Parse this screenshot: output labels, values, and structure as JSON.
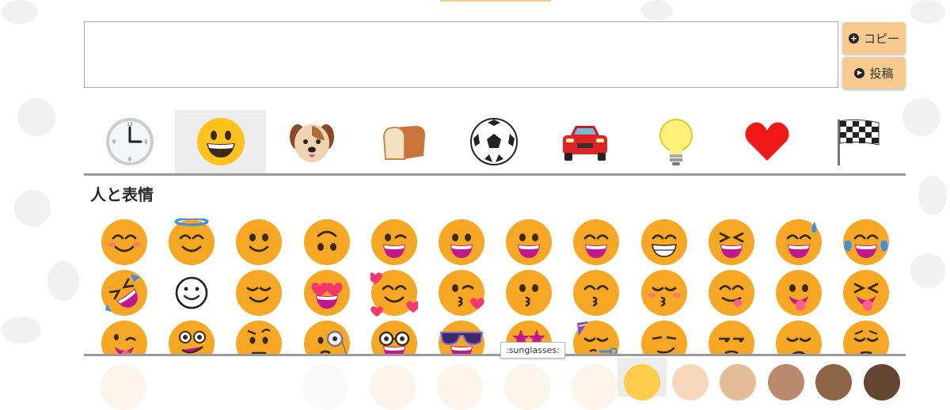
{
  "composer": {
    "text_value": "",
    "copy_label": "コピー",
    "post_label": "投稿"
  },
  "categories": [
    {
      "name": "clock",
      "active": false
    },
    {
      "name": "grinning-face",
      "active": true
    },
    {
      "name": "dog-face",
      "active": false
    },
    {
      "name": "bread",
      "active": false
    },
    {
      "name": "soccer-ball",
      "active": false
    },
    {
      "name": "car",
      "active": false
    },
    {
      "name": "light-bulb",
      "active": false
    },
    {
      "name": "red-heart",
      "active": false
    },
    {
      "name": "chequered-flag",
      "active": false
    }
  ],
  "section": {
    "title": "人と表情"
  },
  "emoji_rows": [
    [
      "smiling-face-with-smiling-eyes",
      "smiling-face-with-halo",
      "slightly-smiling-face",
      "upside-down-face",
      "winking-face",
      "grinning-face-big-eyes",
      "grinning-face",
      "grinning-face-smiling-eyes",
      "beaming-face",
      "grinning-squinting-face",
      "grinning-face-with-sweat",
      "face-with-tears-of-joy"
    ],
    [
      "rolling-on-the-floor-laughing",
      "smiling-face-outline",
      "relieved-face",
      "smiling-face-with-heart-eyes",
      "smiling-face-with-hearts",
      "face-blowing-a-kiss",
      "kissing-face",
      "kissing-face-with-smiling-eyes",
      "kissing-face-with-closed-eyes",
      "face-savoring-food",
      "face-with-tongue",
      "squinting-face-with-tongue"
    ],
    [
      "zany-face",
      "woozy-face",
      "face-with-raised-eyebrow",
      "face-with-monocle",
      "nerd-face",
      "smiling-face-with-sunglasses",
      "star-struck",
      "partying-face",
      "smirking-face",
      "unamused-face",
      "disappointed-face",
      "pensive-face"
    ]
  ],
  "tooltip": {
    "text": ":sunglasses:"
  },
  "skin_tones": [
    {
      "name": "default",
      "color": "#ffcc4d"
    },
    {
      "name": "light",
      "color": "#f7d7bb"
    },
    {
      "name": "medium-light",
      "color": "#e3bd98"
    },
    {
      "name": "medium",
      "color": "#b98a6e"
    },
    {
      "name": "medium-dark",
      "color": "#8c6448"
    },
    {
      "name": "dark",
      "color": "#634733"
    }
  ],
  "colors": {
    "accent": "#f6c98e",
    "face": "#f6a824",
    "mouth": "#c2188f",
    "heart": "#f5366f"
  }
}
